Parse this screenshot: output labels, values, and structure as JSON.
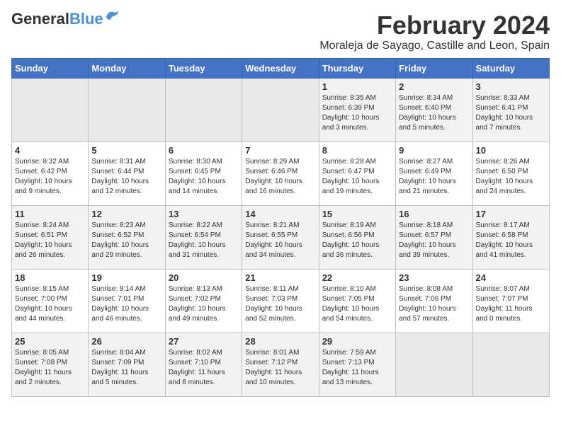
{
  "logo": {
    "general": "General",
    "blue": "Blue"
  },
  "title": {
    "month_year": "February 2024",
    "location": "Moraleja de Sayago, Castille and Leon, Spain"
  },
  "header_days": [
    "Sunday",
    "Monday",
    "Tuesday",
    "Wednesday",
    "Thursday",
    "Friday",
    "Saturday"
  ],
  "weeks": [
    [
      {
        "day": "",
        "info": "",
        "empty": true
      },
      {
        "day": "",
        "info": "",
        "empty": true
      },
      {
        "day": "",
        "info": "",
        "empty": true
      },
      {
        "day": "",
        "info": "",
        "empty": true
      },
      {
        "day": "1",
        "info": "Sunrise: 8:35 AM\nSunset: 6:39 PM\nDaylight: 10 hours\nand 3 minutes.",
        "empty": false
      },
      {
        "day": "2",
        "info": "Sunrise: 8:34 AM\nSunset: 6:40 PM\nDaylight: 10 hours\nand 5 minutes.",
        "empty": false
      },
      {
        "day": "3",
        "info": "Sunrise: 8:33 AM\nSunset: 6:41 PM\nDaylight: 10 hours\nand 7 minutes.",
        "empty": false
      }
    ],
    [
      {
        "day": "4",
        "info": "Sunrise: 8:32 AM\nSunset: 6:42 PM\nDaylight: 10 hours\nand 9 minutes.",
        "empty": false
      },
      {
        "day": "5",
        "info": "Sunrise: 8:31 AM\nSunset: 6:44 PM\nDaylight: 10 hours\nand 12 minutes.",
        "empty": false
      },
      {
        "day": "6",
        "info": "Sunrise: 8:30 AM\nSunset: 6:45 PM\nDaylight: 10 hours\nand 14 minutes.",
        "empty": false
      },
      {
        "day": "7",
        "info": "Sunrise: 8:29 AM\nSunset: 6:46 PM\nDaylight: 10 hours\nand 16 minutes.",
        "empty": false
      },
      {
        "day": "8",
        "info": "Sunrise: 8:28 AM\nSunset: 6:47 PM\nDaylight: 10 hours\nand 19 minutes.",
        "empty": false
      },
      {
        "day": "9",
        "info": "Sunrise: 8:27 AM\nSunset: 6:49 PM\nDaylight: 10 hours\nand 21 minutes.",
        "empty": false
      },
      {
        "day": "10",
        "info": "Sunrise: 8:26 AM\nSunset: 6:50 PM\nDaylight: 10 hours\nand 24 minutes.",
        "empty": false
      }
    ],
    [
      {
        "day": "11",
        "info": "Sunrise: 8:24 AM\nSunset: 6:51 PM\nDaylight: 10 hours\nand 26 minutes.",
        "empty": false
      },
      {
        "day": "12",
        "info": "Sunrise: 8:23 AM\nSunset: 6:52 PM\nDaylight: 10 hours\nand 29 minutes.",
        "empty": false
      },
      {
        "day": "13",
        "info": "Sunrise: 8:22 AM\nSunset: 6:54 PM\nDaylight: 10 hours\nand 31 minutes.",
        "empty": false
      },
      {
        "day": "14",
        "info": "Sunrise: 8:21 AM\nSunset: 6:55 PM\nDaylight: 10 hours\nand 34 minutes.",
        "empty": false
      },
      {
        "day": "15",
        "info": "Sunrise: 8:19 AM\nSunset: 6:56 PM\nDaylight: 10 hours\nand 36 minutes.",
        "empty": false
      },
      {
        "day": "16",
        "info": "Sunrise: 8:18 AM\nSunset: 6:57 PM\nDaylight: 10 hours\nand 39 minutes.",
        "empty": false
      },
      {
        "day": "17",
        "info": "Sunrise: 8:17 AM\nSunset: 6:58 PM\nDaylight: 10 hours\nand 41 minutes.",
        "empty": false
      }
    ],
    [
      {
        "day": "18",
        "info": "Sunrise: 8:15 AM\nSunset: 7:00 PM\nDaylight: 10 hours\nand 44 minutes.",
        "empty": false
      },
      {
        "day": "19",
        "info": "Sunrise: 8:14 AM\nSunset: 7:01 PM\nDaylight: 10 hours\nand 46 minutes.",
        "empty": false
      },
      {
        "day": "20",
        "info": "Sunrise: 8:13 AM\nSunset: 7:02 PM\nDaylight: 10 hours\nand 49 minutes.",
        "empty": false
      },
      {
        "day": "21",
        "info": "Sunrise: 8:11 AM\nSunset: 7:03 PM\nDaylight: 10 hours\nand 52 minutes.",
        "empty": false
      },
      {
        "day": "22",
        "info": "Sunrise: 8:10 AM\nSunset: 7:05 PM\nDaylight: 10 hours\nand 54 minutes.",
        "empty": false
      },
      {
        "day": "23",
        "info": "Sunrise: 8:08 AM\nSunset: 7:06 PM\nDaylight: 10 hours\nand 57 minutes.",
        "empty": false
      },
      {
        "day": "24",
        "info": "Sunrise: 8:07 AM\nSunset: 7:07 PM\nDaylight: 11 hours\nand 0 minutes.",
        "empty": false
      }
    ],
    [
      {
        "day": "25",
        "info": "Sunrise: 8:05 AM\nSunset: 7:08 PM\nDaylight: 11 hours\nand 2 minutes.",
        "empty": false
      },
      {
        "day": "26",
        "info": "Sunrise: 8:04 AM\nSunset: 7:09 PM\nDaylight: 11 hours\nand 5 minutes.",
        "empty": false
      },
      {
        "day": "27",
        "info": "Sunrise: 8:02 AM\nSunset: 7:10 PM\nDaylight: 11 hours\nand 8 minutes.",
        "empty": false
      },
      {
        "day": "28",
        "info": "Sunrise: 8:01 AM\nSunset: 7:12 PM\nDaylight: 11 hours\nand 10 minutes.",
        "empty": false
      },
      {
        "day": "29",
        "info": "Sunrise: 7:59 AM\nSunset: 7:13 PM\nDaylight: 11 hours\nand 13 minutes.",
        "empty": false
      },
      {
        "day": "",
        "info": "",
        "empty": true
      },
      {
        "day": "",
        "info": "",
        "empty": true
      }
    ]
  ]
}
